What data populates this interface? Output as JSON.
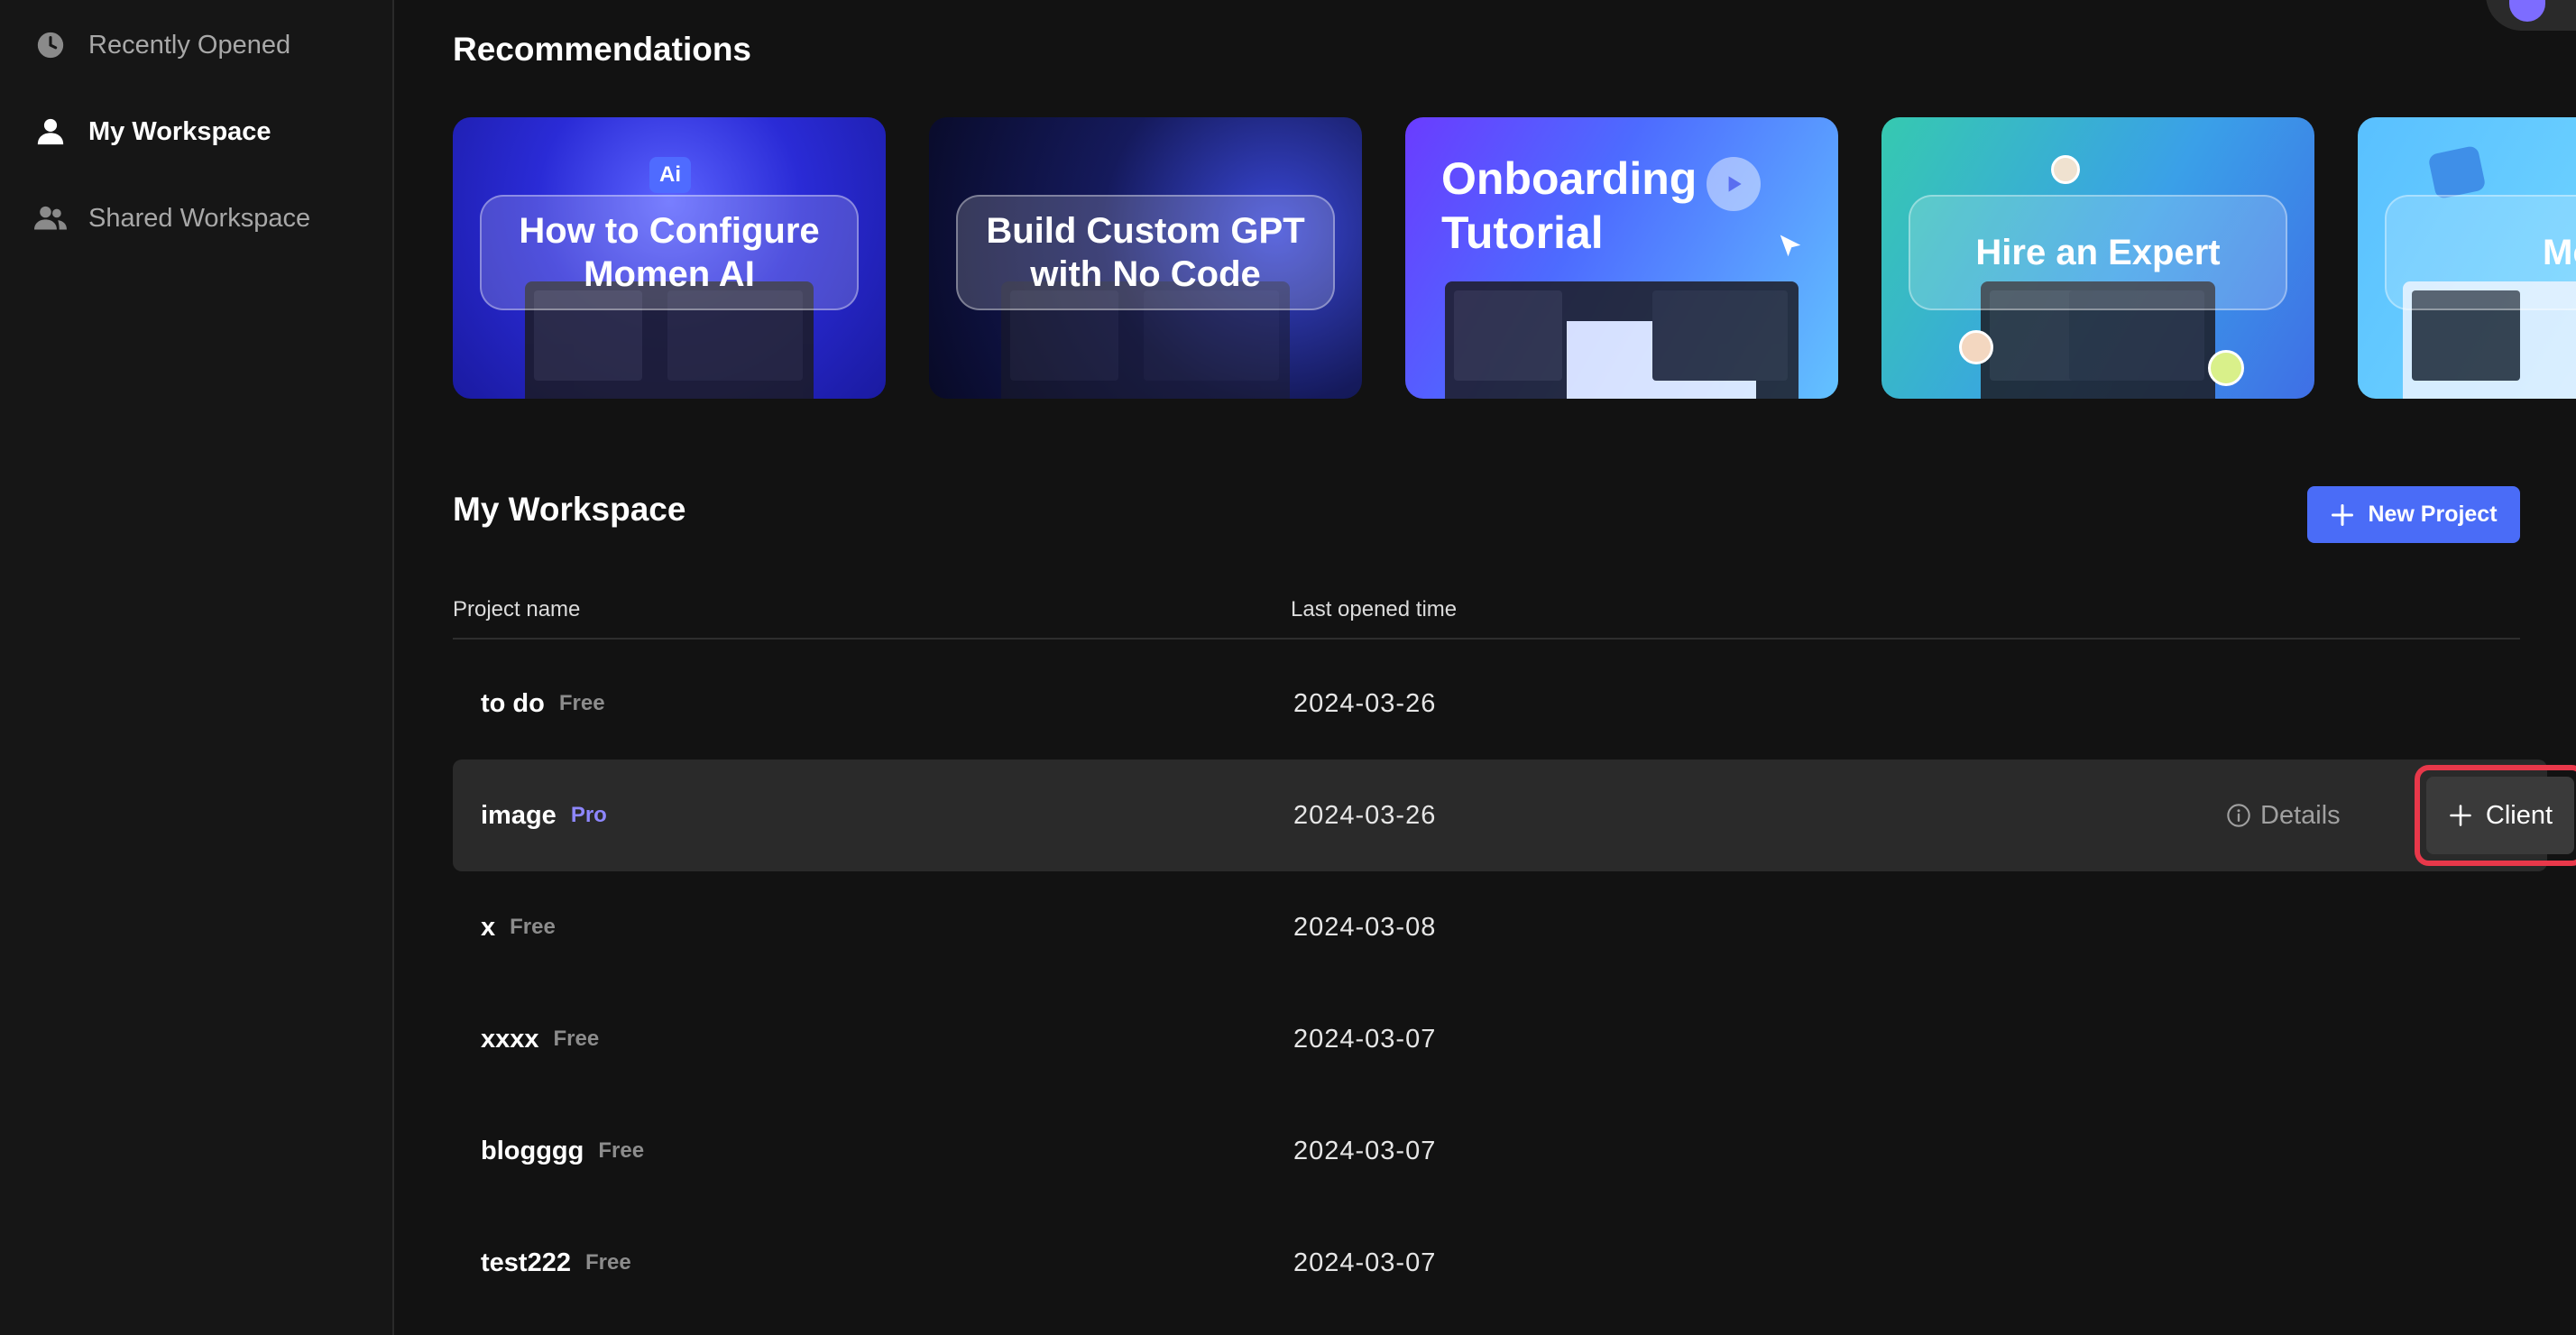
{
  "sidebar": {
    "items": [
      {
        "label": "Recently Opened",
        "icon": "clock-icon",
        "active": false
      },
      {
        "label": "My Workspace",
        "icon": "user-icon",
        "active": true
      },
      {
        "label": "Shared Workspace",
        "icon": "users-icon",
        "active": false
      }
    ]
  },
  "recommendations": {
    "title": "Recommendations",
    "cards": [
      {
        "label": "How to Configure\nMomen AI"
      },
      {
        "label": "Build Custom GPT\nwith No Code"
      },
      {
        "label": "Onboarding\nTutorial"
      },
      {
        "label": "Hire an Expert"
      },
      {
        "label": "Momen"
      }
    ]
  },
  "workspace": {
    "title": "My Workspace",
    "new_project_label": "New Project",
    "columns": {
      "name": "Project name",
      "last_opened": "Last opened time"
    },
    "projects": [
      {
        "name": "to do",
        "plan": "Free",
        "date": "2024-03-26"
      },
      {
        "name": "image",
        "plan": "Pro",
        "date": "2024-03-26"
      },
      {
        "name": "x",
        "plan": "Free",
        "date": "2024-03-08"
      },
      {
        "name": "xxxx",
        "plan": "Free",
        "date": "2024-03-07"
      },
      {
        "name": "blogggg",
        "plan": "Free",
        "date": "2024-03-07"
      },
      {
        "name": "test222",
        "plan": "Free",
        "date": "2024-03-07"
      }
    ],
    "row_actions": {
      "details_label": "Details",
      "client_label": "Client"
    }
  },
  "colors": {
    "accent": "#4a6cf7",
    "pro_badge": "#8e87ff",
    "highlight": "#e8384a",
    "background": "#121212"
  }
}
